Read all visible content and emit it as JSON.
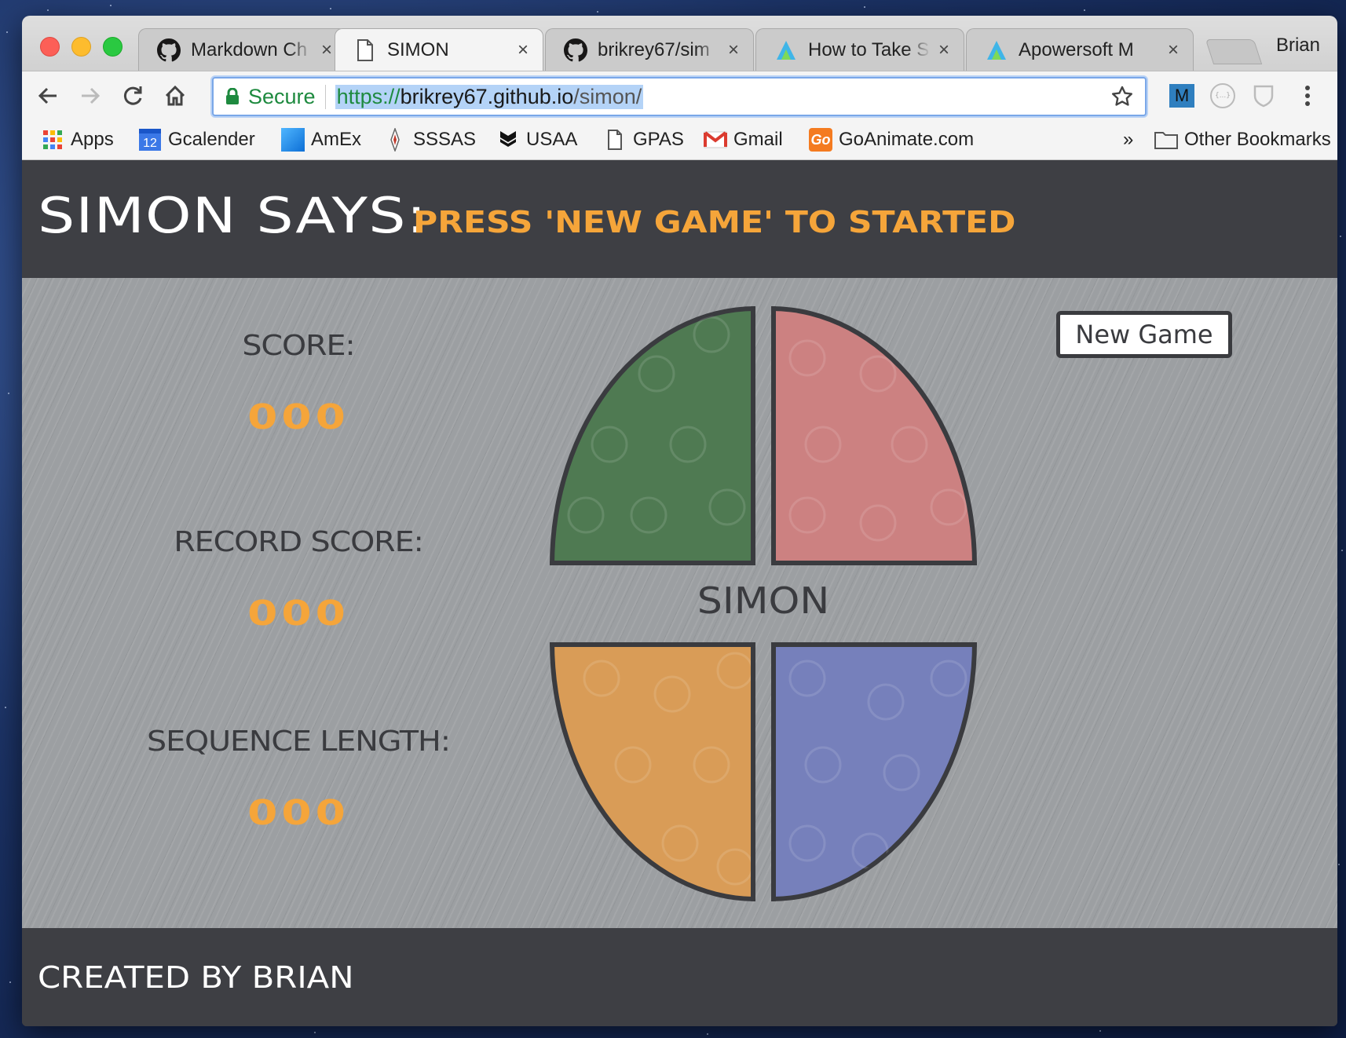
{
  "browser": {
    "tabs": [
      {
        "title": "Markdown Ch",
        "icon": "github-icon",
        "active": false
      },
      {
        "title": "SIMON",
        "icon": "document-icon",
        "active": true
      },
      {
        "title": "brikrey67/sim",
        "icon": "github-icon",
        "active": false
      },
      {
        "title": "How to Take S",
        "icon": "apowersoft-icon",
        "active": false
      },
      {
        "title": "Apowersoft M",
        "icon": "apowersoft-icon",
        "active": false
      }
    ],
    "tab_close_glyph": "×",
    "profile_name": "Brian",
    "omnibox": {
      "secure_label": "Secure",
      "url_scheme": "https://",
      "url_host": "brikrey67.github.io",
      "url_path": "/simon/"
    },
    "extensions": [
      {
        "label": "M",
        "icon": "m-extension-icon"
      },
      {
        "label": "{...}",
        "icon": "json-extension-icon"
      },
      {
        "label": "",
        "icon": "shield-extension-icon"
      }
    ],
    "bookmarks": [
      {
        "label": "Apps",
        "icon": "apps-grid-icon"
      },
      {
        "label": "Gcalender",
        "icon": "calendar-icon",
        "icon_text": "12"
      },
      {
        "label": "AmEx",
        "icon": "amex-icon"
      },
      {
        "label": "SSSAS",
        "icon": "compass-icon"
      },
      {
        "label": "USAA",
        "icon": "usaa-icon"
      },
      {
        "label": "GPAS",
        "icon": "document-icon"
      },
      {
        "label": "Gmail",
        "icon": "gmail-icon"
      },
      {
        "label": "GoAnimate.com",
        "icon": "goanimate-icon",
        "icon_text": "Go"
      }
    ],
    "bookmarks_overflow": "»",
    "other_bookmarks": "Other Bookmarks"
  },
  "page": {
    "header_title": "SIMON SAYS:",
    "status_message": "PRESS 'NEW GAME' TO STARTED",
    "stats": [
      {
        "label": "SCORE:",
        "value": "000"
      },
      {
        "label": "RECORD SCORE:",
        "value": "000"
      },
      {
        "label": "SEQUENCE LENGTH:",
        "value": "000"
      }
    ],
    "board_label": "SIMON",
    "new_game_label": "New Game",
    "footer": "CREATED BY BRIAN",
    "colors": {
      "green": "#4f7a52",
      "red": "#cc8181",
      "yellow": "#d99c57",
      "blue": "#7680bb",
      "accent": "#f5a53a",
      "dark": "#3e3f44"
    }
  }
}
